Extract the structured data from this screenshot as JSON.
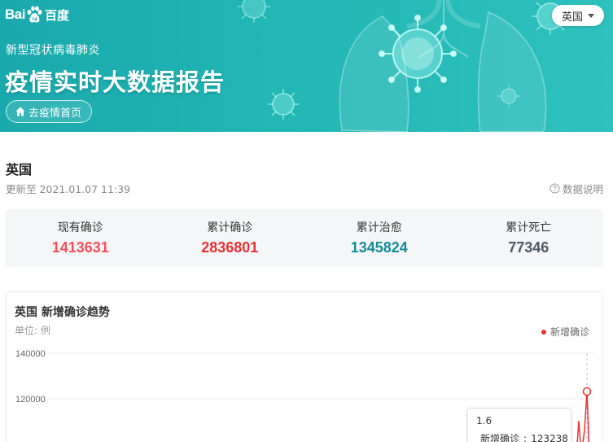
{
  "header": {
    "logo": {
      "prefix": "Bai",
      "suffix": "du",
      "chinese": "百度"
    },
    "subtitle": "新型冠状病毒肺炎",
    "title": "疫情实时大数据报告",
    "home_button": "去疫情首页",
    "country_selector": "英国"
  },
  "region": {
    "name": "英国",
    "update_time": "更新至 2021.01.07 11:39",
    "data_note": "数据说明"
  },
  "stats": [
    {
      "label": "现有确诊",
      "value": "1413631",
      "color": "#f0505a"
    },
    {
      "label": "累计确诊",
      "value": "2836801",
      "color": "#e83132"
    },
    {
      "label": "累计治愈",
      "value": "1345824",
      "color": "#178b96"
    },
    {
      "label": "累计死亡",
      "value": "77346",
      "color": "#4e5a65"
    }
  ],
  "chart": {
    "title": "英国 新增确诊趋势",
    "unit": "单位: 例",
    "legend_label": "新增确诊",
    "series_color": "#e83132",
    "tooltip": {
      "x": "1.6",
      "label": "新增确诊",
      "value": "123238"
    }
  },
  "chart_data": {
    "type": "line",
    "title": "英国 新增确诊趋势",
    "ylabel": "单位: 例",
    "y_ticks": [
      "140000",
      "120000"
    ],
    "ylim_visible": [
      100000,
      140000
    ],
    "series": [
      {
        "name": "新增确诊",
        "x": [
          "1.6"
        ],
        "values": [
          123238
        ]
      }
    ],
    "legend_position": "top-right",
    "grid": true
  }
}
